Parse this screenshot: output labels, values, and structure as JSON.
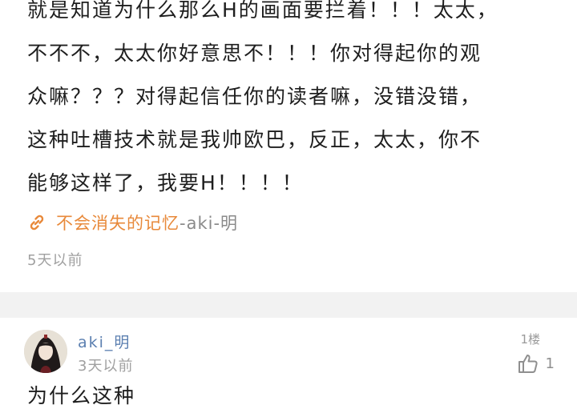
{
  "post": {
    "lines": [
      "就是知道为什么那么H的画面要拦着！！！太太，",
      "不不不，太太你好意思不！！！你对得起你的观",
      "众嘛？？？对得起信任你的读者嘛，没错没错，",
      "这种吐槽技术就是我帅欧巴，反正，太太，你不",
      "能够这样了，我要H！！！！"
    ],
    "source_tag": "不会消失的记忆",
    "source_author": "-aki-明",
    "time": "5天以前",
    "icons": {
      "source": "link-icon"
    },
    "colors": {
      "tag": "#e8893a"
    }
  },
  "comment": {
    "author": "aki_明",
    "time": "3天以前",
    "floor": "1楼",
    "likes": "1",
    "text": "为什么这种",
    "icons": {
      "like": "thumb-up-icon",
      "avatar": "avatar"
    },
    "colors": {
      "author": "#5b7fb0"
    }
  }
}
